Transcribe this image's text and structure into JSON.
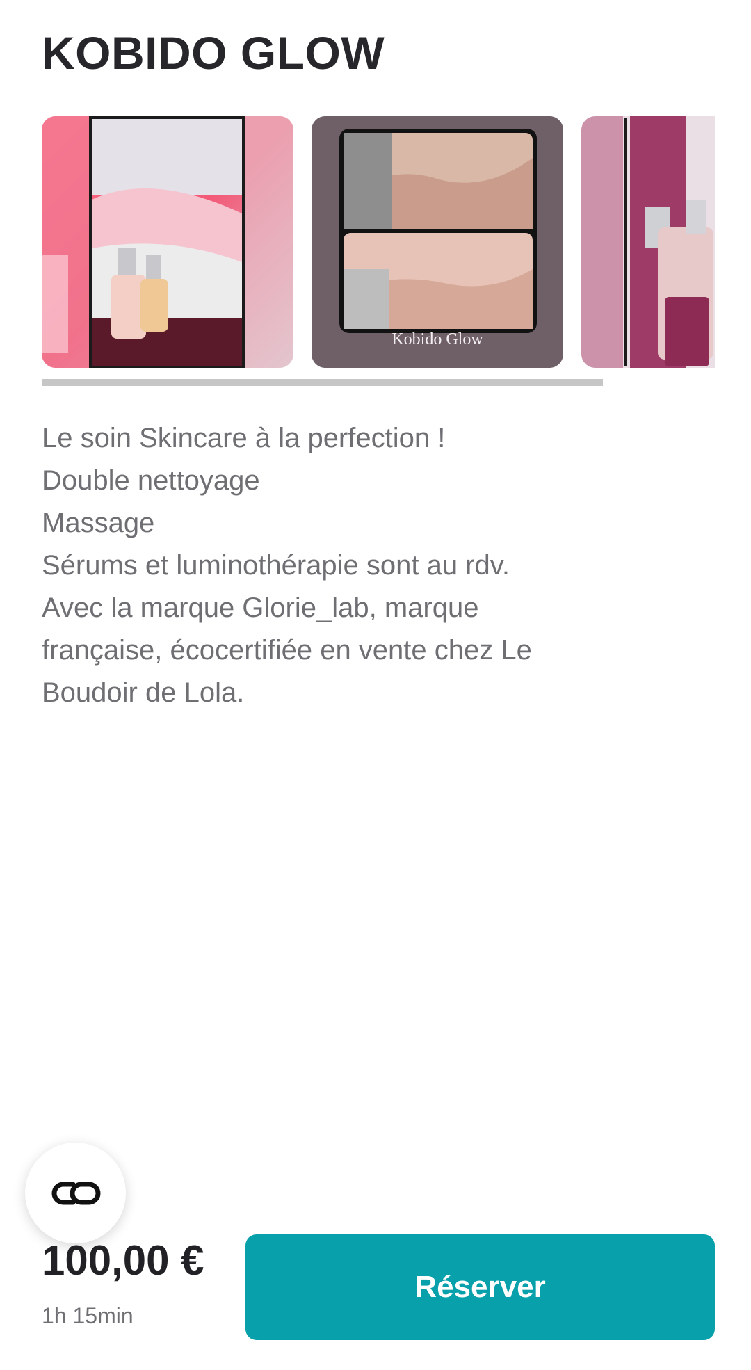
{
  "page": {
    "title": "KOBIDO GLOW"
  },
  "gallery": {
    "images": [
      {
        "alt": "serums-on-pink-towel-photo"
      },
      {
        "alt": "face-before-after-photo",
        "caption": "Kobido Glow"
      },
      {
        "alt": "glorie-products-photo"
      }
    ]
  },
  "description": {
    "lines": [
      "Le soin Skincare à la perfection !",
      "Double nettoyage",
      "Massage",
      "Sérums et luminothérapie sont au rdv.",
      "Avec la marque Glorie_lab, marque",
      "française, écocertifiée en vente chez Le",
      "Boudoir de Lola."
    ]
  },
  "fab": {
    "icon": "link-icon"
  },
  "booking": {
    "price": "100,00 €",
    "duration": "1h 15min",
    "button_label": "Réserver"
  },
  "colors": {
    "accent": "#08a1ab",
    "scrollbar": "#c6c6c6",
    "text_muted": "#6e6e73"
  }
}
